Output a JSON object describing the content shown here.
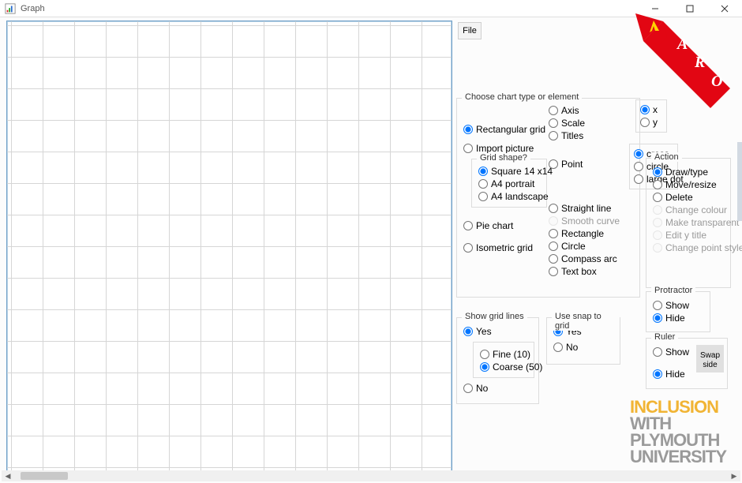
{
  "window": {
    "title": "Graph"
  },
  "menu": {
    "file": "File"
  },
  "chart_type": {
    "legend": "Choose chart type or element",
    "rectangular": "Rectangular grid",
    "import_picture": "Import picture",
    "grid_shape_legend": "Grid shape?",
    "square": "Square 14 x14",
    "a4_portrait": "A4 portrait",
    "a4_landscape": "A4 landscape",
    "pie_chart": "Pie chart",
    "isometric": "Isometric grid",
    "axis": "Axis",
    "scale": "Scale",
    "titles": "Titles",
    "x": "x",
    "y": "y",
    "point": "Point",
    "cross": "cross",
    "circle_pt": "circle",
    "large_dot": "large dot",
    "straight_line": "Straight line",
    "smooth_curve": "Smooth curve",
    "rectangle": "Rectangle",
    "circle": "Circle",
    "compass_arc": "Compass arc",
    "text_box": "Text box"
  },
  "action": {
    "legend": "Action",
    "draw": "Draw/type",
    "move": "Move/resize",
    "delete": "Delete",
    "change_colour": "Change colour",
    "make_transparent": "Make transparent",
    "edit_y_title": "Edit y title",
    "change_point_style": "Change point style"
  },
  "protractor": {
    "legend": "Protractor",
    "show": "Show",
    "hide": "Hide"
  },
  "ruler": {
    "legend": "Ruler",
    "show": "Show",
    "hide": "Hide",
    "swap": "Swap side"
  },
  "gridlines": {
    "legend": "Show grid lines",
    "yes": "Yes",
    "no": "No",
    "fine": "Fine (10)",
    "coarse": "Coarse (50)"
  },
  "snap": {
    "legend": "Use snap to grid",
    "yes": "Yes",
    "no": "No"
  },
  "logo": {
    "l1": "INCLUSION",
    "l2a": "WITH",
    "l2b": "PLYMOUTH",
    "l2c": "UNIVERSITY"
  }
}
